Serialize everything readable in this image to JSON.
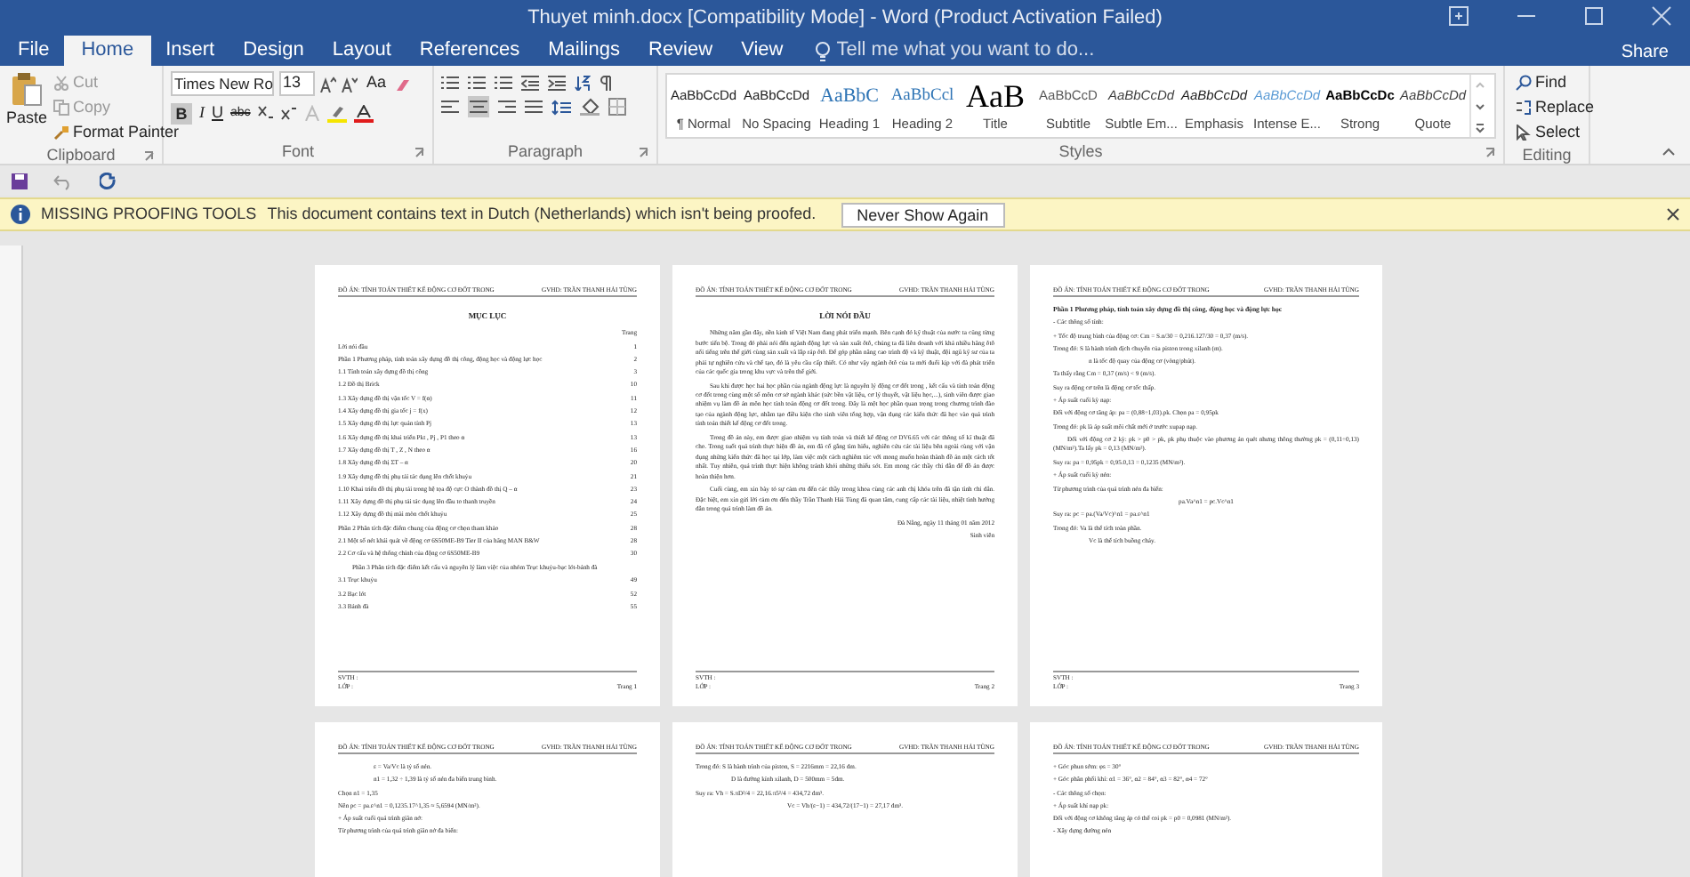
{
  "window": {
    "title": "Thuyet minh.docx [Compatibility Mode] - Word (Product Activation Failed)",
    "share": "Share"
  },
  "tabs": [
    {
      "label": "File",
      "selected": false
    },
    {
      "label": "Home",
      "selected": true
    },
    {
      "label": "Insert",
      "selected": false
    },
    {
      "label": "Design",
      "selected": false
    },
    {
      "label": "Layout",
      "selected": false
    },
    {
      "label": "References",
      "selected": false
    },
    {
      "label": "Mailings",
      "selected": false
    },
    {
      "label": "Review",
      "selected": false
    },
    {
      "label": "View",
      "selected": false
    }
  ],
  "tell_me": {
    "placeholder": "Tell me what you want to do..."
  },
  "clipboard": {
    "paste": "Paste",
    "cut": "Cut",
    "copy": "Copy",
    "format_painter": "Format Painter",
    "label": "Clipboard"
  },
  "font": {
    "name": "Times New Ro",
    "size": "13",
    "change_case": "Aa",
    "bold": "B",
    "italic": "I",
    "underline": "U",
    "strike": "abc",
    "label": "Font"
  },
  "paragraph": {
    "label": "Paragraph"
  },
  "styles": {
    "label": "Styles",
    "items": [
      {
        "preview": "AaBbCcDd",
        "label": "¶ Normal",
        "kind": "normal"
      },
      {
        "preview": "AaBbCcDd",
        "label": "No Spacing",
        "kind": "normal"
      },
      {
        "preview": "AaBbC",
        "label": "Heading 1",
        "kind": "heading1"
      },
      {
        "preview": "AaBbCcl",
        "label": "Heading 2",
        "kind": "heading2"
      },
      {
        "preview": "AaB",
        "label": "Title",
        "kind": "title"
      },
      {
        "preview": "AaBbCcD",
        "label": "Subtitle",
        "kind": "subtitle"
      },
      {
        "preview": "AaBbCcDd",
        "label": "Subtle Em...",
        "kind": "italic"
      },
      {
        "preview": "AaBbCcDd",
        "label": "Emphasis",
        "kind": "emphasis"
      },
      {
        "preview": "AaBbCcDd",
        "label": "Intense E...",
        "kind": "intense"
      },
      {
        "preview": "AaBbCcDc",
        "label": "Strong",
        "kind": "strong"
      },
      {
        "preview": "AaBbCcDd",
        "label": "Quote",
        "kind": "italic"
      }
    ]
  },
  "editing": {
    "find": "Find",
    "replace": "Replace",
    "select": "Select",
    "label": "Editing"
  },
  "message_bar": {
    "title": "MISSING PROOFING TOOLS",
    "text": "This document contains text in Dutch (Netherlands) which isn't being proofed.",
    "button": "Never Show Again"
  },
  "pages": [
    {
      "header_left": "ĐỒ ÁN: TÍNH TOÁN THIẾT KẾ ĐỘNG CƠ ĐỐT TRONG",
      "header_right": "GVHD: TRẦN THANH HẢI TÙNG",
      "footer_left": [
        "SVTH :",
        "LỚP :"
      ],
      "footer_right": "Trang 1",
      "lines": [
        {
          "kind": "title",
          "text": "MỤC LỤC"
        },
        {
          "kind": "right",
          "text": "Trang"
        },
        {
          "kind": "toc",
          "text": "Lời nói đầu",
          "page": "1"
        },
        {
          "kind": "toc",
          "text": "Phần 1 Phương pháp, tính toán xây dựng đồ thị công, động học và động lực học",
          "page": "2"
        },
        {
          "kind": "toc",
          "text": "1.1 Tính toán xây dựng đồ thị công",
          "page": "3"
        },
        {
          "kind": "toc",
          "text": "1.2 Đồ thị Brick",
          "page": "10"
        },
        {
          "kind": "toc",
          "text": "1.3 Xây dựng đồ thị vận tốc V = f(α)",
          "page": "11"
        },
        {
          "kind": "toc",
          "text": "1.4 Xây dựng đồ thị gia tốc j = f(x)",
          "page": "12"
        },
        {
          "kind": "toc",
          "text": "1.5 Xây dựng đồ thị lực quán tính Pj",
          "page": "13"
        },
        {
          "kind": "toc",
          "text": "1.6 Xây dựng đồ thị khai triển Pkt , Pj , P1 theo α",
          "page": "13"
        },
        {
          "kind": "toc",
          "text": "1.7 Xây dựng đồ thị T , Z , N theo α",
          "page": "16"
        },
        {
          "kind": "toc",
          "text": "1.8 Xây dựng đồ thị ΣT – α",
          "page": "20"
        },
        {
          "kind": "toc",
          "text": "1.9 Xây dựng đồ thị phụ tải tác dụng lên chốt khuỷu",
          "page": "21"
        },
        {
          "kind": "toc",
          "text": "1.10 Khai triển đồ thị phụ tải trong hệ tọa độ cực O thành đồ thị Q – α",
          "page": "23"
        },
        {
          "kind": "toc",
          "text": "1.11 Xây dựng đồ thị phụ tải tác dụng lên đầu to thanh truyền",
          "page": "24"
        },
        {
          "kind": "toc",
          "text": "1.12 Xây dựng đồ thị mài mòn chốt khuỷu",
          "page": "25"
        },
        {
          "kind": "toc",
          "text": "Phần 2 Phân tích đặc điểm chung của động cơ chọn tham khảo",
          "page": "28"
        },
        {
          "kind": "toc",
          "text": "2.1 Một số nét khái quát về động cơ 6S50ME-B9 Tier II của hãng MAN B&W",
          "page": "28"
        },
        {
          "kind": "toc",
          "text": "2.2 Cơ cấu và hệ thống chính của động cơ 6S50ME-B9",
          "page": "30"
        },
        {
          "kind": "para",
          "text": "Phần 3 Phân tích đặc điểm kết cấu và nguyên lý làm việc của nhóm Trục khuỷu-bạc lót-bánh đà"
        },
        {
          "kind": "toc",
          "text": "3.1 Trục khuỷu",
          "page": "49"
        },
        {
          "kind": "toc",
          "text": "3.2 Bạc lót",
          "page": "52"
        },
        {
          "kind": "toc",
          "text": "3.3 Bánh đà",
          "page": "55"
        }
      ]
    },
    {
      "header_left": "ĐỒ ÁN: TÍNH TOÁN THIẾT KẾ ĐỘNG CƠ ĐỐT TRONG",
      "header_right": "GVHD: TRẦN THANH HẢI TÙNG",
      "footer_left": [
        "SVTH :",
        "LỚP :"
      ],
      "footer_right": "Trang 2",
      "lines": [
        {
          "kind": "title",
          "text": "LỜI NÓI ĐẦU"
        },
        {
          "kind": "para",
          "text": "Những năm gần đây, nền kinh tế Việt Nam đang phát triển mạnh. Bên cạnh đó kỹ thuật của nước ta cũng từng bước tiến bộ. Trong đó phải nói đến ngành động lực và sản xuất ôtô, chúng ta đã liên doanh với khá nhiều hãng ôtô nổi tiếng trên thế giới cùng sản xuất và lắp ráp ôtô. Để góp phần nâng cao trình độ và kỹ thuật, đội ngũ kỹ sư của ta phải tự nghiên cứu và chế tạo, đó là yêu cầu cấp thiết. Có như vậy ngành ôtô của ta mới đuổi kịp với đà phát triển của các quốc gia trong khu vực và trên thế giới."
        },
        {
          "kind": "para",
          "text": "Sau khi được học hai học phần của ngành động lực là nguyên lý động cơ đốt trong , kết cấu và tính toán động cơ đốt trong cùng một số môn cơ sở ngành khác (sức bền vật liệu, cơ lý thuyết, vật liệu học,...), sinh viên được giao nhiệm vụ làm đồ án môn học tính toán động cơ đốt trong. Đây là một học phần quan trọng trong chương trình đào tạo của ngành động lực, nhằm tạo điều kiện cho sinh viên tổng hợp, vận dụng các kiến thức đã học vào quá trình tính toán thiết kế động cơ đốt trong."
        },
        {
          "kind": "para",
          "text": "Trong đồ án này, em được giao nhiệm vụ tính toán và thiết kế động cơ DV6.65 với các thông số kĩ thuật đã cho. Trong suốt quá trình thực hiện đồ án, em đã cố gắng tìm hiểu, nghiên cứu các tài liệu bên ngoài cùng với vận dụng những kiến thức đã học tại lớp, làm việc một cách nghiêm túc với mong muốn hoàn thành đồ án một cách tốt nhất. Tuy nhiên, quá trình thực hiện không tránh khỏi những thiếu sót. Em mong các thầy chỉ dẫn để đồ án được hoàn thiện hơn."
        },
        {
          "kind": "para",
          "text": "Cuối cùng, em xin bày tỏ sự cảm ơn đến các thầy trong khoa cùng các anh chị khóa trên đã tận tình chỉ dẫn. Đặc biệt, em xin gửi lời cảm ơn đến thầy Trần Thanh Hải Tùng đã quan tâm, cung cấp các tài liệu, nhiệt tình hướng dẫn trong quá trình làm đồ án."
        },
        {
          "kind": "right",
          "text": "Đà Nẵng, ngày 11 tháng 01 năm 2012"
        },
        {
          "kind": "right",
          "text": "Sinh viên"
        }
      ]
    },
    {
      "header_left": "ĐỒ ÁN: TÍNH TOÁN THIẾT KẾ ĐỘNG CƠ ĐỐT TRONG",
      "header_right": "GVHD: TRẦN THANH HẢI TÙNG",
      "footer_left": [
        "SVTH :",
        "LỚP :"
      ],
      "footer_right": "Trang 3",
      "lines": [
        {
          "kind": "heading",
          "text": "Phần 1 Phương pháp, tính toán xây dựng đồ thị công, động học và động lực học"
        },
        {
          "kind": "line",
          "text": "- Các thông số tính:"
        },
        {
          "kind": "line",
          "text": "+ Tốc độ trung bình của động cơ: Cm = S.n/30 = 0,216.127/30 = 0,37 (m/s)."
        },
        {
          "kind": "line",
          "text": "Trong đó: S là hành trình dịch chuyển của piston trong xilanh (m)."
        },
        {
          "kind": "indent",
          "text": "n là tốc độ quay của động cơ (vòng/phút)."
        },
        {
          "kind": "line",
          "text": "Ta thấy rằng Cm = 0,37 (m/s) < 9 (m/s)."
        },
        {
          "kind": "line",
          "text": "Suy ra động cơ trên là động cơ tốc thấp."
        },
        {
          "kind": "line",
          "text": "+ Áp suất cuối kỳ nạp:"
        },
        {
          "kind": "line",
          "text": "Đối với động cơ tăng áp: pa = (0,88÷1,03).pk. Chọn pa = 0,95pk"
        },
        {
          "kind": "line",
          "text": "Trong đó: pk là áp suất môi chất mới ở trước xupap nạp."
        },
        {
          "kind": "para",
          "text": "Đối với động cơ 2 kỳ: pk > p0 > pk, pk phụ thuộc vào phương án quét nhưng thông thường pk = (0,11÷0,13) (MN/m²).Ta lấy pk = 0,13 (MN/m²)."
        },
        {
          "kind": "line",
          "text": "Suy ra: pa = 0,95pk = 0,95.0,13 = 0,1235 (MN/m²)."
        },
        {
          "kind": "line",
          "text": "+ Áp suất cuối kỳ nén:"
        },
        {
          "kind": "line",
          "text": "Từ phương trình của quá trình nén đa biến:"
        },
        {
          "kind": "center",
          "text": "pa.Va^n1 = pc.Vc^n1"
        },
        {
          "kind": "line",
          "text": "Suy ra: pc = pa.(Va/Vc)^n1 = pa.ε^n1"
        },
        {
          "kind": "line",
          "text": "Trong đó: Va là thể tích toàn phần."
        },
        {
          "kind": "indent",
          "text": "Vc là thể tích buồng cháy."
        }
      ]
    },
    {
      "header_left": "ĐỒ ÁN: TÍNH TOÁN THIẾT KẾ ĐỘNG CƠ ĐỐT TRONG",
      "header_right": "GVHD: TRẦN THANH HẢI TÙNG",
      "lines": [
        {
          "kind": "indent",
          "text": "ε = Va/Vc là tỷ số nén."
        },
        {
          "kind": "indent",
          "text": "n1 = 1,32 ÷ 1,39 là tỷ số nén đa biến trung bình."
        },
        {
          "kind": "line",
          "text": "Chọn n1 = 1,35"
        },
        {
          "kind": "line",
          "text": "Nên pc = pa.ε^n1 = 0,1235.17^1,35 ≈ 5,6594 (MN/m²)."
        },
        {
          "kind": "line",
          "text": "+ Áp suất cuối quá trình giãn nở:"
        },
        {
          "kind": "line",
          "text": "Từ phương trình của quá trình giãn nở đa biến:"
        }
      ]
    },
    {
      "header_left": "ĐỒ ÁN: TÍNH TOÁN THIẾT KẾ ĐỘNG CƠ ĐỐT TRONG",
      "header_right": "GVHD: TRẦN THANH HẢI TÙNG",
      "lines": [
        {
          "kind": "line",
          "text": "Trong đó: S là hành trình của piston, S = 2216mm = 22,16 dm."
        },
        {
          "kind": "indent",
          "text": "D là đường kính xilanh, D = 500mm = 5dm."
        },
        {
          "kind": "line",
          "text": "Suy ra: Vh = S.πD²/4 = 22,16.π5²/4 = 434,72 dm³."
        },
        {
          "kind": "center",
          "text": "Vc = Vh/(ε−1) = 434,72/(17−1) = 27,17 dm³."
        }
      ]
    },
    {
      "header_left": "ĐỒ ÁN: TÍNH TOÁN THIẾT KẾ ĐỘNG CƠ ĐỐT TRONG",
      "header_right": "GVHD: TRẦN THANH HẢI TÙNG",
      "lines": [
        {
          "kind": "line",
          "text": "+ Góc phun sớm: φs = 30°"
        },
        {
          "kind": "line",
          "text": "+ Góc phân phối khí: α1 = 36°, α2 = 84°, α3 = 82°, α4 = 72°"
        },
        {
          "kind": "line",
          "text": "- Các thông số chọn:"
        },
        {
          "kind": "line",
          "text": "+ Áp suất khí nạp pk:"
        },
        {
          "kind": "line",
          "text": "Đối với động cơ không tăng áp có thể coi pk = p0 = 0,0981 (MN/m²)."
        },
        {
          "kind": "line",
          "text": "- Xây dựng đường nén"
        }
      ]
    }
  ]
}
